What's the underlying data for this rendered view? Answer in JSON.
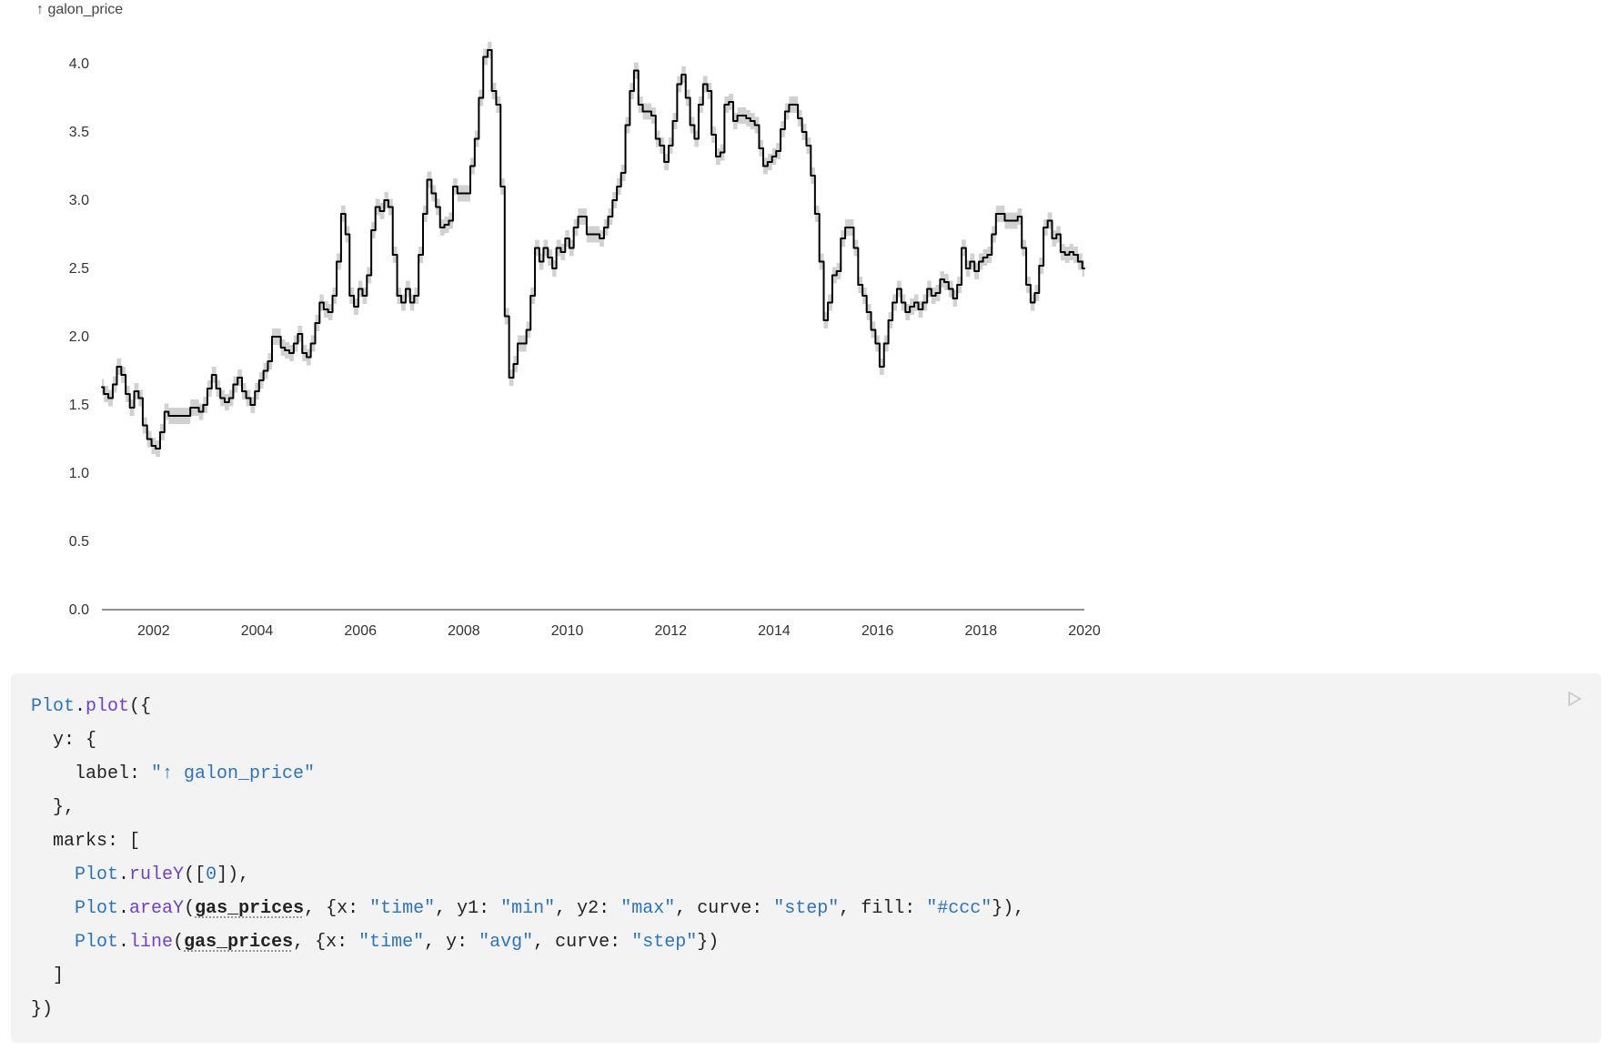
{
  "chart_data": {
    "type": "line",
    "title": "",
    "xlabel": "",
    "ylabel": "↑ galon_price",
    "ylim": [
      0.0,
      4.2
    ],
    "xlim": [
      2001,
      2020
    ],
    "x_ticks": [
      2002,
      2004,
      2006,
      2008,
      2010,
      2012,
      2014,
      2016,
      2018,
      2020
    ],
    "y_ticks": [
      0.0,
      0.5,
      1.0,
      1.5,
      2.0,
      2.5,
      3.0,
      3.5,
      4.0
    ],
    "series": [
      {
        "name": "avg",
        "curve": "step",
        "data": [
          {
            "x": 2001.0,
            "y": 1.63
          },
          {
            "x": 2001.08,
            "y": 1.58
          },
          {
            "x": 2001.17,
            "y": 1.55
          },
          {
            "x": 2001.25,
            "y": 1.65
          },
          {
            "x": 2001.33,
            "y": 1.78
          },
          {
            "x": 2001.42,
            "y": 1.72
          },
          {
            "x": 2001.5,
            "y": 1.58
          },
          {
            "x": 2001.58,
            "y": 1.48
          },
          {
            "x": 2001.67,
            "y": 1.6
          },
          {
            "x": 2001.75,
            "y": 1.55
          },
          {
            "x": 2001.83,
            "y": 1.35
          },
          {
            "x": 2001.92,
            "y": 1.25
          },
          {
            "x": 2002.0,
            "y": 1.2
          },
          {
            "x": 2002.08,
            "y": 1.18
          },
          {
            "x": 2002.17,
            "y": 1.3
          },
          {
            "x": 2002.25,
            "y": 1.45
          },
          {
            "x": 2002.33,
            "y": 1.42
          },
          {
            "x": 2002.42,
            "y": 1.42
          },
          {
            "x": 2002.5,
            "y": 1.42
          },
          {
            "x": 2002.58,
            "y": 1.42
          },
          {
            "x": 2002.67,
            "y": 1.42
          },
          {
            "x": 2002.75,
            "y": 1.48
          },
          {
            "x": 2002.83,
            "y": 1.48
          },
          {
            "x": 2002.92,
            "y": 1.45
          },
          {
            "x": 2003.0,
            "y": 1.5
          },
          {
            "x": 2003.08,
            "y": 1.62
          },
          {
            "x": 2003.17,
            "y": 1.72
          },
          {
            "x": 2003.25,
            "y": 1.62
          },
          {
            "x": 2003.33,
            "y": 1.55
          },
          {
            "x": 2003.42,
            "y": 1.52
          },
          {
            "x": 2003.5,
            "y": 1.55
          },
          {
            "x": 2003.58,
            "y": 1.65
          },
          {
            "x": 2003.67,
            "y": 1.7
          },
          {
            "x": 2003.75,
            "y": 1.6
          },
          {
            "x": 2003.83,
            "y": 1.55
          },
          {
            "x": 2003.92,
            "y": 1.5
          },
          {
            "x": 2004.0,
            "y": 1.6
          },
          {
            "x": 2004.08,
            "y": 1.68
          },
          {
            "x": 2004.17,
            "y": 1.75
          },
          {
            "x": 2004.25,
            "y": 1.82
          },
          {
            "x": 2004.33,
            "y": 2.0
          },
          {
            "x": 2004.42,
            "y": 2.0
          },
          {
            "x": 2004.5,
            "y": 1.92
          },
          {
            "x": 2004.58,
            "y": 1.9
          },
          {
            "x": 2004.67,
            "y": 1.88
          },
          {
            "x": 2004.75,
            "y": 1.95
          },
          {
            "x": 2004.83,
            "y": 2.02
          },
          {
            "x": 2004.92,
            "y": 1.88
          },
          {
            "x": 2005.0,
            "y": 1.85
          },
          {
            "x": 2005.08,
            "y": 1.95
          },
          {
            "x": 2005.17,
            "y": 2.1
          },
          {
            "x": 2005.25,
            "y": 2.25
          },
          {
            "x": 2005.33,
            "y": 2.2
          },
          {
            "x": 2005.42,
            "y": 2.18
          },
          {
            "x": 2005.5,
            "y": 2.3
          },
          {
            "x": 2005.58,
            "y": 2.55
          },
          {
            "x": 2005.67,
            "y": 2.9
          },
          {
            "x": 2005.75,
            "y": 2.75
          },
          {
            "x": 2005.83,
            "y": 2.3
          },
          {
            "x": 2005.92,
            "y": 2.22
          },
          {
            "x": 2006.0,
            "y": 2.35
          },
          {
            "x": 2006.08,
            "y": 2.3
          },
          {
            "x": 2006.17,
            "y": 2.45
          },
          {
            "x": 2006.25,
            "y": 2.78
          },
          {
            "x": 2006.33,
            "y": 2.95
          },
          {
            "x": 2006.42,
            "y": 2.92
          },
          {
            "x": 2006.5,
            "y": 3.0
          },
          {
            "x": 2006.58,
            "y": 2.95
          },
          {
            "x": 2006.67,
            "y": 2.6
          },
          {
            "x": 2006.75,
            "y": 2.3
          },
          {
            "x": 2006.83,
            "y": 2.25
          },
          {
            "x": 2006.92,
            "y": 2.35
          },
          {
            "x": 2007.0,
            "y": 2.25
          },
          {
            "x": 2007.08,
            "y": 2.3
          },
          {
            "x": 2007.17,
            "y": 2.6
          },
          {
            "x": 2007.25,
            "y": 2.9
          },
          {
            "x": 2007.33,
            "y": 3.15
          },
          {
            "x": 2007.42,
            "y": 3.05
          },
          {
            "x": 2007.5,
            "y": 2.95
          },
          {
            "x": 2007.58,
            "y": 2.8
          },
          {
            "x": 2007.67,
            "y": 2.82
          },
          {
            "x": 2007.75,
            "y": 2.85
          },
          {
            "x": 2007.83,
            "y": 3.1
          },
          {
            "x": 2007.92,
            "y": 3.05
          },
          {
            "x": 2008.0,
            "y": 3.05
          },
          {
            "x": 2008.08,
            "y": 3.05
          },
          {
            "x": 2008.17,
            "y": 3.25
          },
          {
            "x": 2008.25,
            "y": 3.45
          },
          {
            "x": 2008.33,
            "y": 3.75
          },
          {
            "x": 2008.42,
            "y": 4.05
          },
          {
            "x": 2008.5,
            "y": 4.1
          },
          {
            "x": 2008.58,
            "y": 3.8
          },
          {
            "x": 2008.67,
            "y": 3.7
          },
          {
            "x": 2008.75,
            "y": 3.1
          },
          {
            "x": 2008.83,
            "y": 2.15
          },
          {
            "x": 2008.92,
            "y": 1.7
          },
          {
            "x": 2009.0,
            "y": 1.8
          },
          {
            "x": 2009.08,
            "y": 1.95
          },
          {
            "x": 2009.17,
            "y": 1.95
          },
          {
            "x": 2009.25,
            "y": 2.05
          },
          {
            "x": 2009.33,
            "y": 2.3
          },
          {
            "x": 2009.42,
            "y": 2.65
          },
          {
            "x": 2009.5,
            "y": 2.55
          },
          {
            "x": 2009.58,
            "y": 2.65
          },
          {
            "x": 2009.67,
            "y": 2.58
          },
          {
            "x": 2009.75,
            "y": 2.5
          },
          {
            "x": 2009.83,
            "y": 2.65
          },
          {
            "x": 2009.92,
            "y": 2.62
          },
          {
            "x": 2010.0,
            "y": 2.72
          },
          {
            "x": 2010.08,
            "y": 2.65
          },
          {
            "x": 2010.17,
            "y": 2.8
          },
          {
            "x": 2010.25,
            "y": 2.88
          },
          {
            "x": 2010.33,
            "y": 2.88
          },
          {
            "x": 2010.42,
            "y": 2.75
          },
          {
            "x": 2010.5,
            "y": 2.75
          },
          {
            "x": 2010.58,
            "y": 2.75
          },
          {
            "x": 2010.67,
            "y": 2.72
          },
          {
            "x": 2010.75,
            "y": 2.8
          },
          {
            "x": 2010.83,
            "y": 2.88
          },
          {
            "x": 2010.92,
            "y": 3.0
          },
          {
            "x": 2011.0,
            "y": 3.1
          },
          {
            "x": 2011.08,
            "y": 3.2
          },
          {
            "x": 2011.17,
            "y": 3.55
          },
          {
            "x": 2011.25,
            "y": 3.8
          },
          {
            "x": 2011.33,
            "y": 3.95
          },
          {
            "x": 2011.42,
            "y": 3.7
          },
          {
            "x": 2011.5,
            "y": 3.65
          },
          {
            "x": 2011.58,
            "y": 3.65
          },
          {
            "x": 2011.67,
            "y": 3.62
          },
          {
            "x": 2011.75,
            "y": 3.45
          },
          {
            "x": 2011.83,
            "y": 3.4
          },
          {
            "x": 2011.92,
            "y": 3.28
          },
          {
            "x": 2012.0,
            "y": 3.4
          },
          {
            "x": 2012.08,
            "y": 3.58
          },
          {
            "x": 2012.17,
            "y": 3.85
          },
          {
            "x": 2012.25,
            "y": 3.92
          },
          {
            "x": 2012.33,
            "y": 3.75
          },
          {
            "x": 2012.42,
            "y": 3.55
          },
          {
            "x": 2012.5,
            "y": 3.45
          },
          {
            "x": 2012.58,
            "y": 3.7
          },
          {
            "x": 2012.67,
            "y": 3.85
          },
          {
            "x": 2012.75,
            "y": 3.8
          },
          {
            "x": 2012.83,
            "y": 3.48
          },
          {
            "x": 2012.92,
            "y": 3.32
          },
          {
            "x": 2013.0,
            "y": 3.35
          },
          {
            "x": 2013.08,
            "y": 3.7
          },
          {
            "x": 2013.17,
            "y": 3.72
          },
          {
            "x": 2013.25,
            "y": 3.58
          },
          {
            "x": 2013.33,
            "y": 3.62
          },
          {
            "x": 2013.42,
            "y": 3.62
          },
          {
            "x": 2013.5,
            "y": 3.6
          },
          {
            "x": 2013.58,
            "y": 3.58
          },
          {
            "x": 2013.67,
            "y": 3.55
          },
          {
            "x": 2013.75,
            "y": 3.38
          },
          {
            "x": 2013.83,
            "y": 3.25
          },
          {
            "x": 2013.92,
            "y": 3.28
          },
          {
            "x": 2014.0,
            "y": 3.32
          },
          {
            "x": 2014.08,
            "y": 3.36
          },
          {
            "x": 2014.17,
            "y": 3.52
          },
          {
            "x": 2014.25,
            "y": 3.65
          },
          {
            "x": 2014.33,
            "y": 3.7
          },
          {
            "x": 2014.42,
            "y": 3.7
          },
          {
            "x": 2014.5,
            "y": 3.6
          },
          {
            "x": 2014.58,
            "y": 3.5
          },
          {
            "x": 2014.67,
            "y": 3.4
          },
          {
            "x": 2014.75,
            "y": 3.18
          },
          {
            "x": 2014.83,
            "y": 2.9
          },
          {
            "x": 2014.92,
            "y": 2.55
          },
          {
            "x": 2015.0,
            "y": 2.12
          },
          {
            "x": 2015.08,
            "y": 2.25
          },
          {
            "x": 2015.17,
            "y": 2.45
          },
          {
            "x": 2015.25,
            "y": 2.48
          },
          {
            "x": 2015.33,
            "y": 2.72
          },
          {
            "x": 2015.42,
            "y": 2.8
          },
          {
            "x": 2015.5,
            "y": 2.8
          },
          {
            "x": 2015.58,
            "y": 2.65
          },
          {
            "x": 2015.67,
            "y": 2.38
          },
          {
            "x": 2015.75,
            "y": 2.3
          },
          {
            "x": 2015.83,
            "y": 2.18
          },
          {
            "x": 2015.92,
            "y": 2.05
          },
          {
            "x": 2016.0,
            "y": 1.95
          },
          {
            "x": 2016.08,
            "y": 1.78
          },
          {
            "x": 2016.17,
            "y": 1.95
          },
          {
            "x": 2016.25,
            "y": 2.12
          },
          {
            "x": 2016.33,
            "y": 2.25
          },
          {
            "x": 2016.42,
            "y": 2.35
          },
          {
            "x": 2016.5,
            "y": 2.25
          },
          {
            "x": 2016.58,
            "y": 2.18
          },
          {
            "x": 2016.67,
            "y": 2.22
          },
          {
            "x": 2016.75,
            "y": 2.25
          },
          {
            "x": 2016.83,
            "y": 2.2
          },
          {
            "x": 2016.92,
            "y": 2.25
          },
          {
            "x": 2017.0,
            "y": 2.35
          },
          {
            "x": 2017.08,
            "y": 2.3
          },
          {
            "x": 2017.17,
            "y": 2.32
          },
          {
            "x": 2017.25,
            "y": 2.42
          },
          {
            "x": 2017.33,
            "y": 2.4
          },
          {
            "x": 2017.42,
            "y": 2.35
          },
          {
            "x": 2017.5,
            "y": 2.28
          },
          {
            "x": 2017.58,
            "y": 2.38
          },
          {
            "x": 2017.67,
            "y": 2.65
          },
          {
            "x": 2017.75,
            "y": 2.5
          },
          {
            "x": 2017.83,
            "y": 2.55
          },
          {
            "x": 2017.92,
            "y": 2.48
          },
          {
            "x": 2018.0,
            "y": 2.55
          },
          {
            "x": 2018.08,
            "y": 2.58
          },
          {
            "x": 2018.17,
            "y": 2.6
          },
          {
            "x": 2018.25,
            "y": 2.75
          },
          {
            "x": 2018.33,
            "y": 2.9
          },
          {
            "x": 2018.42,
            "y": 2.9
          },
          {
            "x": 2018.5,
            "y": 2.85
          },
          {
            "x": 2018.58,
            "y": 2.85
          },
          {
            "x": 2018.67,
            "y": 2.85
          },
          {
            "x": 2018.75,
            "y": 2.88
          },
          {
            "x": 2018.83,
            "y": 2.65
          },
          {
            "x": 2018.92,
            "y": 2.38
          },
          {
            "x": 2019.0,
            "y": 2.25
          },
          {
            "x": 2019.08,
            "y": 2.32
          },
          {
            "x": 2019.17,
            "y": 2.52
          },
          {
            "x": 2019.25,
            "y": 2.8
          },
          {
            "x": 2019.33,
            "y": 2.85
          },
          {
            "x": 2019.42,
            "y": 2.72
          },
          {
            "x": 2019.5,
            "y": 2.75
          },
          {
            "x": 2019.58,
            "y": 2.62
          },
          {
            "x": 2019.67,
            "y": 2.6
          },
          {
            "x": 2019.75,
            "y": 2.62
          },
          {
            "x": 2019.83,
            "y": 2.6
          },
          {
            "x": 2019.92,
            "y": 2.55
          },
          {
            "x": 2020.0,
            "y": 2.5
          }
        ]
      }
    ],
    "band": {
      "name": "min/max",
      "fill": "#ccc",
      "offset": 0.06
    }
  },
  "y_axis_label": "↑ galon_price",
  "code": {
    "line1": "Plot.plot({",
    "line2_pre": "  y: {",
    "line3_pre": "    label: ",
    "line3_str": "\"↑ galon_price\"",
    "line4": "  },",
    "line5": "  marks: [",
    "line6_pre": "    Plot.ruleY([",
    "line6_num": "0",
    "line6_suf": "]),",
    "line7_pre": "    Plot.areaY(",
    "var_gas": "gas_prices",
    "line7_mid": ", {x: ",
    "s_time": "\"time\"",
    "line7_y1": ", y1: ",
    "s_min": "\"min\"",
    "line7_y2": ", y2: ",
    "s_max": "\"max\"",
    "line7_curve": ", curve: ",
    "s_step": "\"step\"",
    "line7_fill": ", fill: ",
    "s_ccc": "\"#ccc\"",
    "line7_suf": "}),",
    "line8_pre": "    Plot.line(",
    "line8_mid": ", {x: ",
    "line8_y": ", y: ",
    "s_avg": "\"avg\"",
    "line8_curve": ", curve: ",
    "line8_suf": "})",
    "line9": "  ]",
    "line10": "})"
  }
}
